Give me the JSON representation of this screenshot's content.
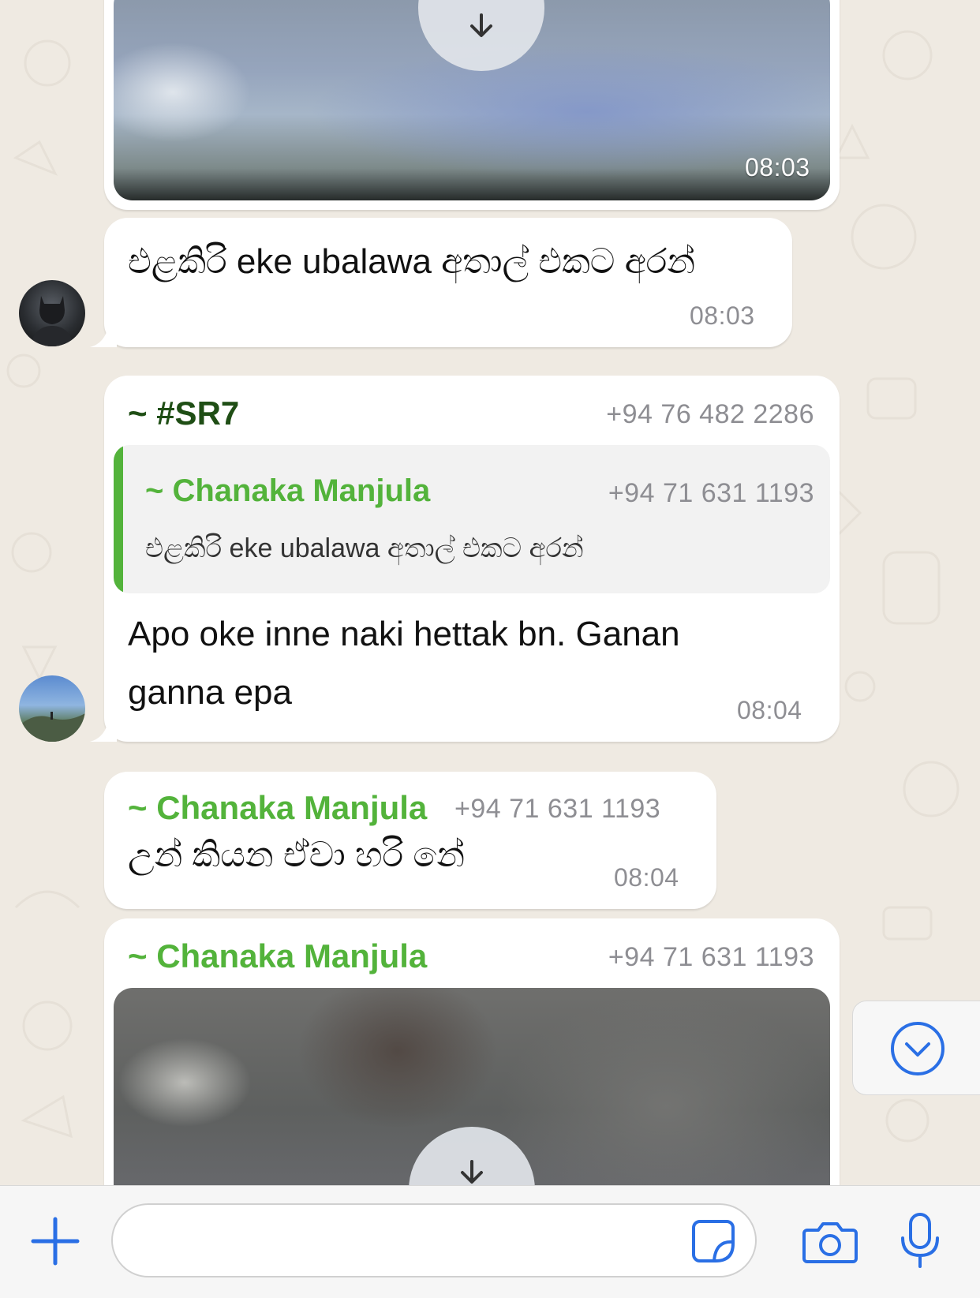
{
  "colors": {
    "sender_green": "#53b33b",
    "sender_dark_green": "#1f4e15",
    "accent_blue": "#2a6fe5",
    "bubble": "#ffffff",
    "background": "#efeae2"
  },
  "messages": [
    {
      "type": "media",
      "time": "08:03",
      "icon": "download-arrow-icon"
    },
    {
      "type": "text",
      "text": "එළකිරි eke ubalawa අතාල් එකට අරන්",
      "time": "08:03",
      "avatar": "batman-avatar"
    },
    {
      "type": "reply",
      "sender": "~ #SR7",
      "phone": "+94 76 482 2286",
      "quoted_sender": "~ Chanaka Manjula",
      "quoted_phone": "+94 71 631 1193",
      "quoted_text": "එළකිරි eke ubalawa අතාල් එකට අරන්",
      "text_line1": "Apo oke inne naki hettak bn. Ganan",
      "text_line2": "ganna epa",
      "time": "08:04",
      "avatar": "landscape-avatar"
    },
    {
      "type": "text",
      "sender": "~ Chanaka Manjula",
      "phone": "+94 71 631 1193",
      "text": "උන් කියන ඒවා හරි නේ",
      "time": "08:04"
    },
    {
      "type": "media",
      "sender": "~ Chanaka Manjula",
      "phone": "+94 71 631 1193",
      "icon": "download-arrow-icon"
    }
  ],
  "composer": {
    "placeholder": "",
    "icons": [
      "plus-icon",
      "sticker-icon",
      "camera-icon",
      "microphone-icon"
    ]
  },
  "scroll_button": {
    "icon": "chevron-down-circle-icon"
  }
}
